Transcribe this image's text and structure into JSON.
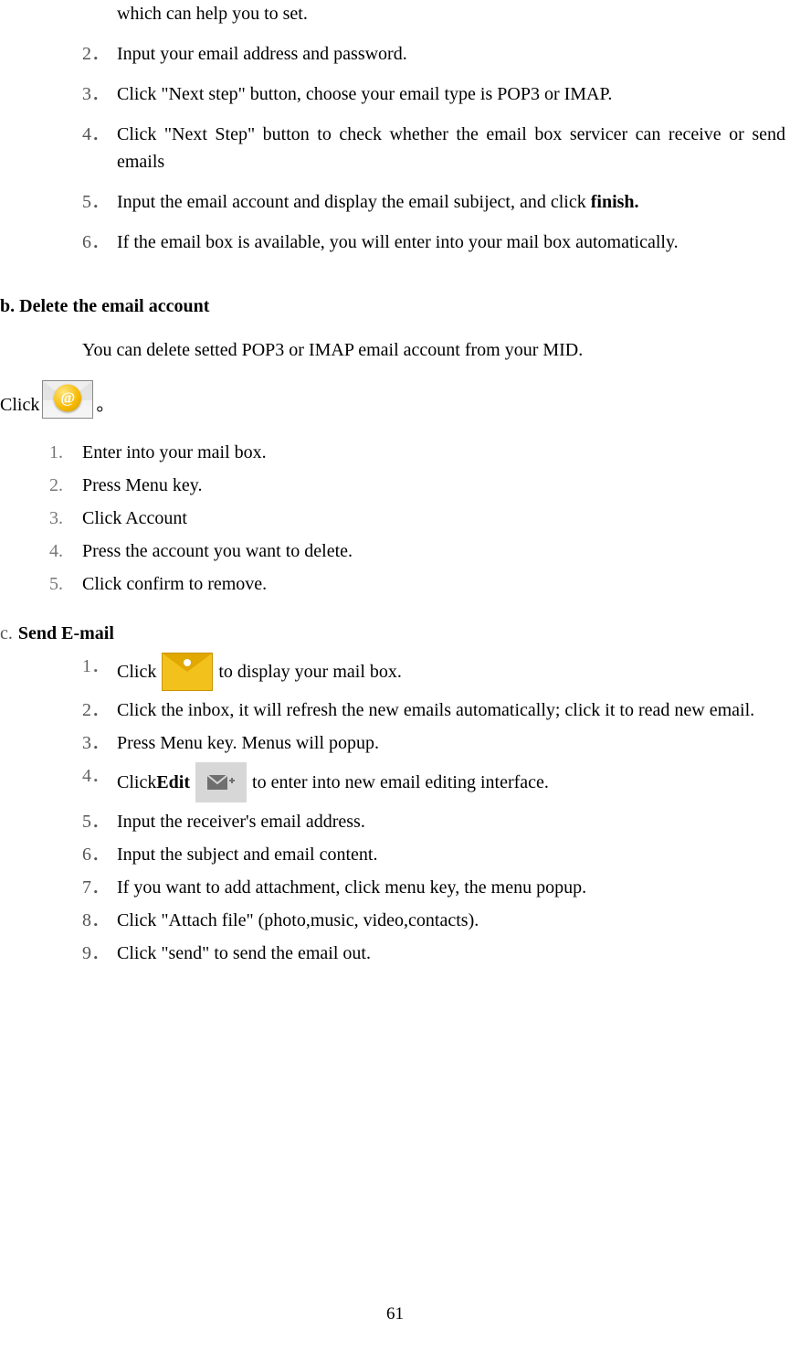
{
  "listA": {
    "item1_cont": "which can help you to set.",
    "n2": "2．",
    "t2": "Input your email address and password.",
    "n3": "3．",
    "t3": "Click \"Next step\" button, choose your email type is POP3 or IMAP.",
    "n4": "4．",
    "t4": "Click \"Next Step\" button to check whether the email box servicer can receive or send emails",
    "n5": "5．",
    "t5a": "Input the email account and display the email subiject, and click ",
    "t5b": "finish.",
    "n6": "6．",
    "t6": "If the email box is available, you will enter into your mail box automatically."
  },
  "sectionB": {
    "title": "b. Delete the email account",
    "desc": "You can delete setted POP3 or IMAP email account from your MID.",
    "click_pre": "Click",
    "click_post": "。"
  },
  "listB": {
    "n1": "1.",
    "t1": "Enter into your mail box.",
    "n2": "2.",
    "t2": "Press Menu key.",
    "n3": "3.",
    "t3": "Click Account",
    "n4": "4.",
    "t4": "Press the account you want to delete.",
    "n5": "5.",
    "t5": "Click confirm to remove."
  },
  "sectionC": {
    "label": "c.",
    "title": "Send E-mail"
  },
  "listC": {
    "n1": "1．",
    "t1a": "Click ",
    "t1b": " to display your mail box.",
    "n2": "2．",
    "t2": "Click the inbox, it will refresh the new emails automatically; click it to read new email.",
    "n3": "3．",
    "t3": "Press Menu key. Menus will popup.",
    "n4": "4．",
    "t4a": "Click ",
    "t4edit": "Edit",
    "t4b": "  to enter into new email editing interface.",
    "n5": "5．",
    "t5": "Input the receiver's email address.",
    "n6": "6．",
    "t6": "Input the subject and email content.",
    "n7": "7．",
    "t7": "If you want to add attachment, click menu key, the menu popup.",
    "n8": "8．",
    "t8": "Click \"Attach file\" (photo,music, video,contacts).",
    "n9": "9．",
    "t9": "Click \"send\" to send the email out."
  },
  "pageNumber": "61"
}
